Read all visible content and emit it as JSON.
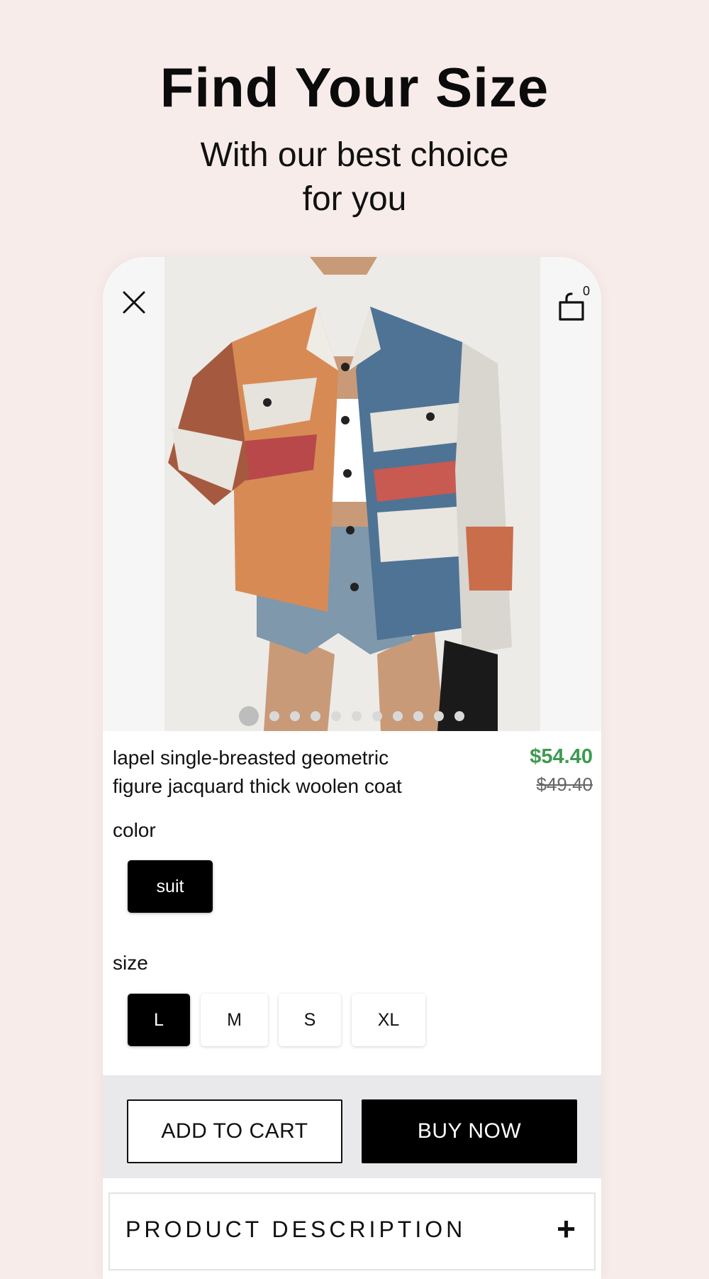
{
  "hero": {
    "title": "Find Your Size",
    "subtitle_line1": "With our best choice",
    "subtitle_line2": "for you"
  },
  "header": {
    "close_icon": "close-icon",
    "cart_icon": "shopping-bag-icon",
    "cart_count": "0"
  },
  "gallery": {
    "image_count": 11,
    "active_index": 0
  },
  "product": {
    "name_line1": "lapel single-breasted geometric",
    "name_line2": "figure jacquard thick woolen coat",
    "price": "$54.40",
    "original_price": "$49.40",
    "price_color": "#3e9b4f"
  },
  "color": {
    "label": "color",
    "options": [
      "suit"
    ],
    "selected": "suit"
  },
  "size": {
    "label": "size",
    "options": [
      "L",
      "M",
      "S",
      "XL"
    ],
    "selected": "L"
  },
  "actions": {
    "add_to_cart": "ADD TO CART",
    "buy_now": "BUY NOW"
  },
  "description": {
    "label": "PRODUCT DESCRIPTION",
    "expand_icon": "+"
  }
}
